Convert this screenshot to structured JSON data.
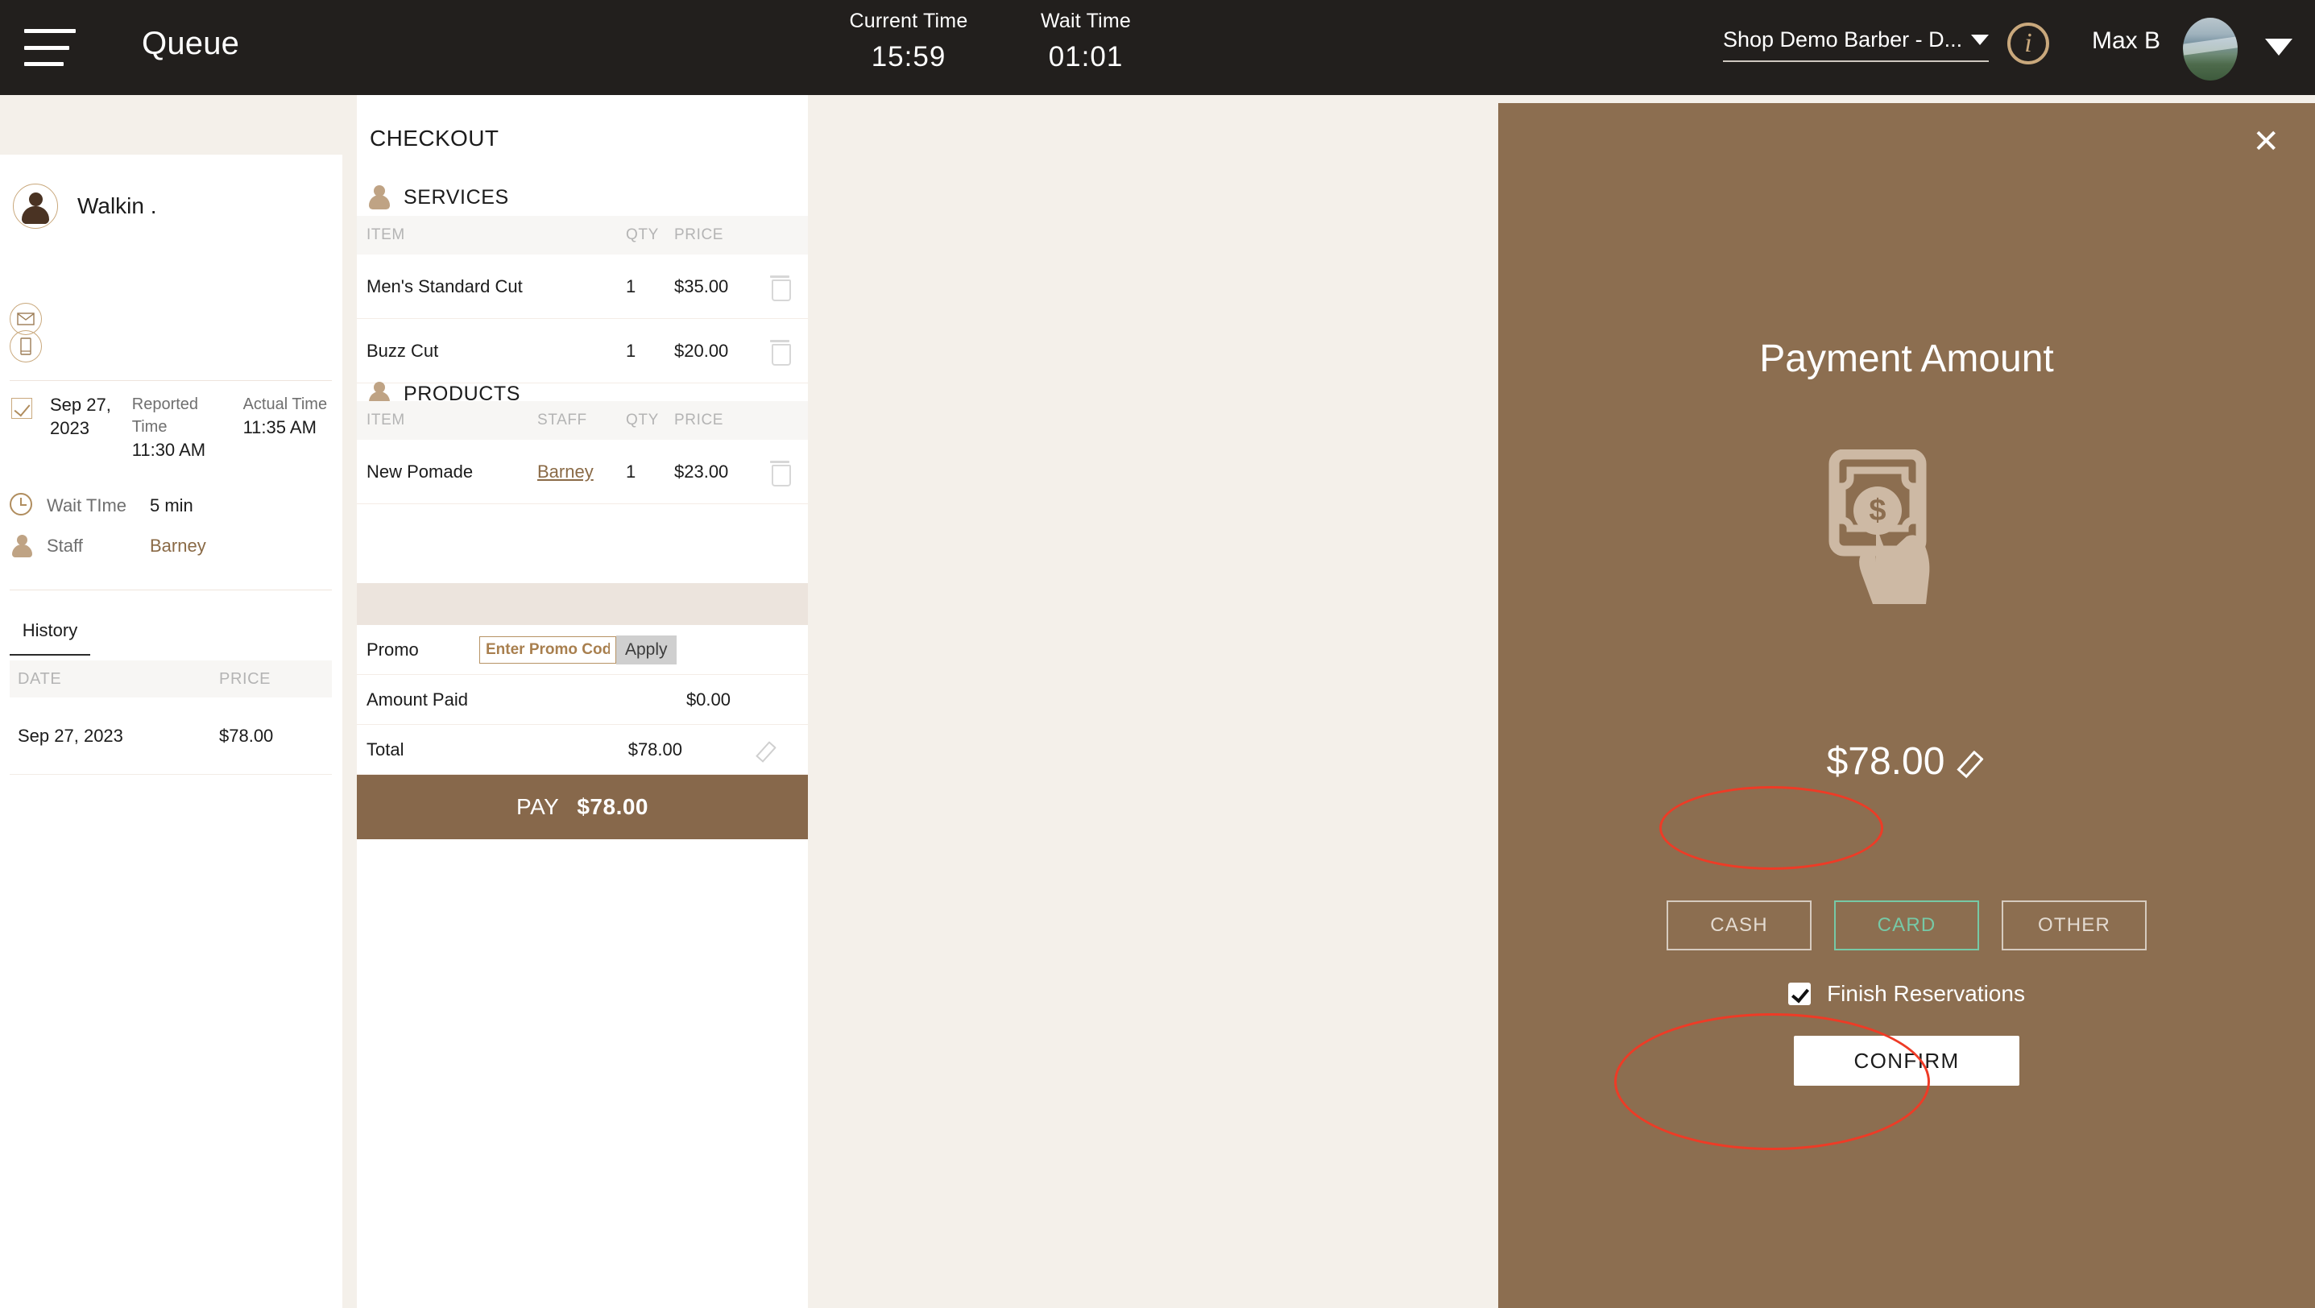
{
  "topbar": {
    "menu_icon": "hamburger-icon",
    "title": "Queue",
    "current_time_label": "Current Time",
    "current_time_value": "15:59",
    "wait_time_label": "Wait Time",
    "wait_time_value": "01:01",
    "shop_selector": "Shop Demo Barber - D...",
    "info_icon": "i",
    "user_name": "Max B",
    "background": "#221f1d"
  },
  "customer": {
    "name": "Walkin .",
    "mail_icon": "mail-icon",
    "phone_icon": "phone-icon",
    "appointment": {
      "date": "Sep 27, 2023",
      "reported_time_label": "Reported Time",
      "reported_time_value": "11:30 AM",
      "actual_time_label": "Actual Time",
      "actual_time_value": "11:35 AM"
    },
    "wait_time_label": "Wait TIme",
    "wait_time_value": "5 min",
    "staff_label": "Staff",
    "staff_value": "Barney",
    "history": {
      "tab_label": "History",
      "columns": [
        "DATE",
        "PRICE"
      ],
      "rows": [
        {
          "date": "Sep 27, 2023",
          "price": "$78.00"
        }
      ]
    }
  },
  "checkout": {
    "title": "CHECKOUT",
    "services": {
      "section_label": "SERVICES",
      "columns": {
        "item": "ITEM",
        "qty": "QTY",
        "price": "PRICE"
      },
      "rows": [
        {
          "item": "Men's Standard Cut",
          "qty": "1",
          "price": "$35.00"
        },
        {
          "item": "Buzz Cut",
          "qty": "1",
          "price": "$20.00"
        }
      ]
    },
    "products": {
      "section_label": "PRODUCTS",
      "columns": {
        "item": "ITEM",
        "staff": "STAFF",
        "qty": "QTY",
        "price": "PRICE"
      },
      "rows": [
        {
          "item": "New Pomade",
          "staff": "Barney",
          "qty": "1",
          "price": "$23.00"
        }
      ]
    },
    "promo": {
      "label": "Promo",
      "placeholder": "Enter Promo Code",
      "value": "",
      "apply_label": "Apply"
    },
    "amount_paid_label": "Amount Paid",
    "amount_paid_value": "$0.00",
    "total_label": "Total",
    "total_value": "$78.00",
    "pay_label": "PAY",
    "pay_amount": "$78.00",
    "pay_bar_color": "#87684b"
  },
  "payment_panel": {
    "close_label": "✕",
    "heading": "Payment Amount",
    "icon": "mobile-payment-icon",
    "amount": "$78.00",
    "methods": [
      {
        "label": "CASH",
        "selected": false
      },
      {
        "label": "CARD",
        "selected": true
      },
      {
        "label": "OTHER",
        "selected": false
      }
    ],
    "finish_reservations_label": "Finish Reservations",
    "finish_reservations_checked": true,
    "confirm_label": "CONFIRM",
    "panel_color": "#8c6e50",
    "selected_color": "#76c9a6",
    "annotation_color": "#ee3b26"
  }
}
